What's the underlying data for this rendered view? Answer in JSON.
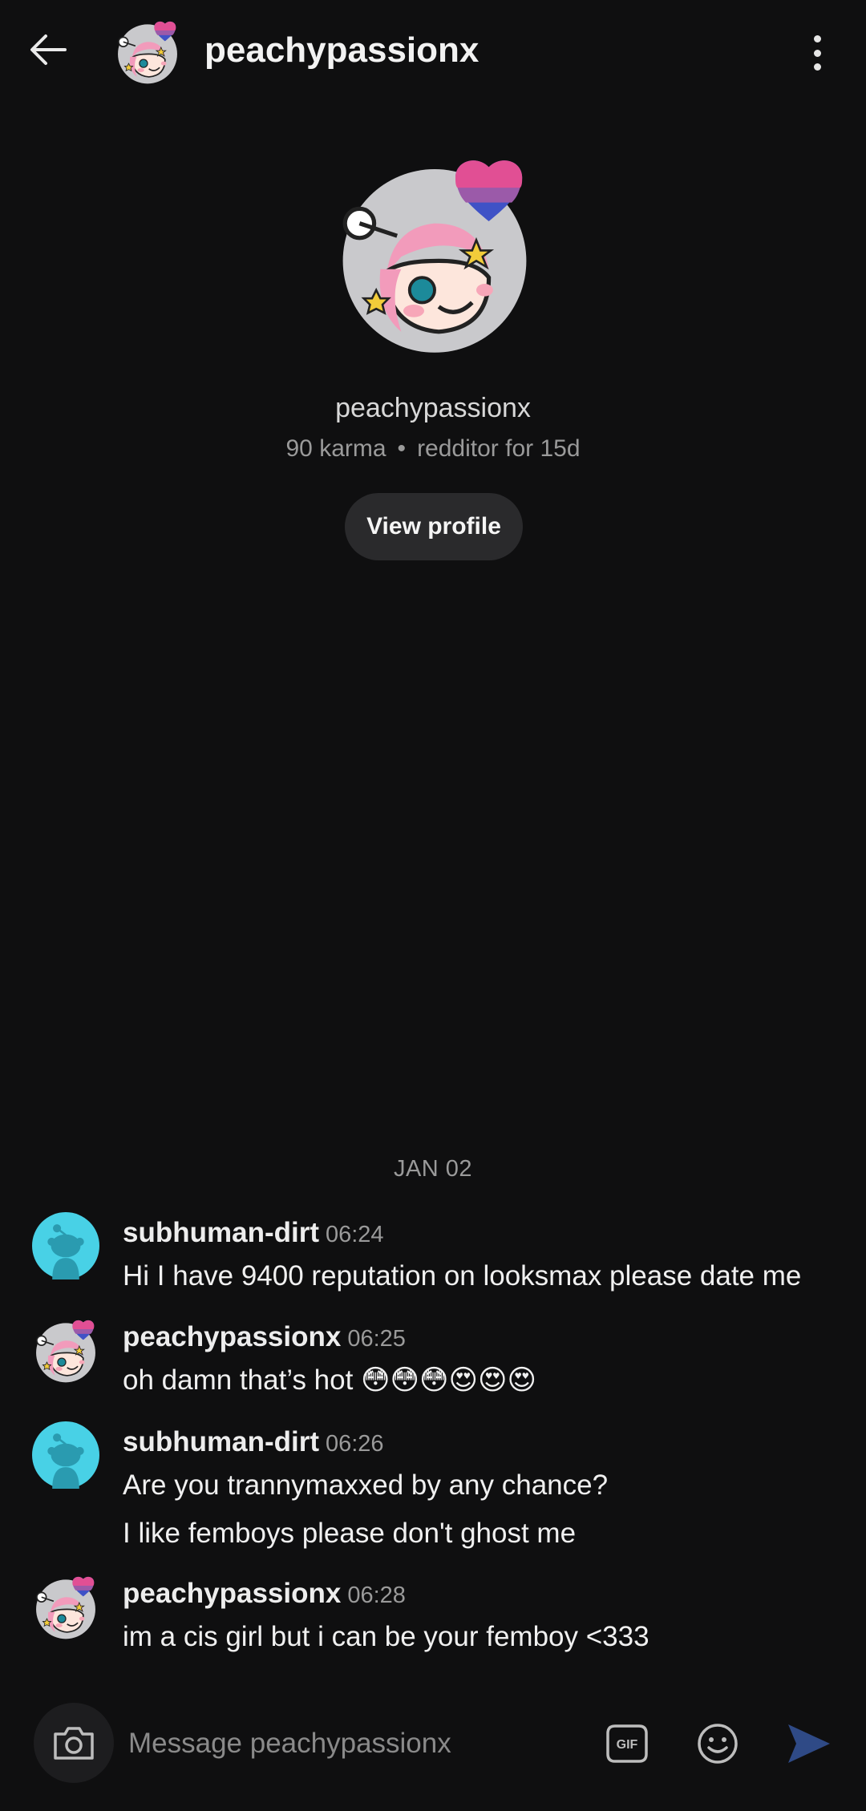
{
  "header": {
    "title": "peachypassionx",
    "back_icon": "arrow-left-icon",
    "more_icon": "more-vertical-icon"
  },
  "profile": {
    "name": "peachypassionx",
    "karma": "90 karma",
    "separator": "•",
    "age": "redditor for 15d",
    "view_profile_label": "View profile"
  },
  "date_separator": "JAN 02",
  "messages": [
    {
      "sender": "subhuman-dirt",
      "time": "06:24",
      "lines": [
        "Hi I have 9400 reputation on looksmax please date me"
      ]
    },
    {
      "sender": "peachypassionx",
      "time": "06:25",
      "lines": [
        "oh damn that’s hot 😳😳😳😍😍😍"
      ]
    },
    {
      "sender": "subhuman-dirt",
      "time": "06:26",
      "lines": [
        "Are you trannymaxxed by any chance?",
        "I like femboys please don't ghost me"
      ]
    },
    {
      "sender": "peachypassionx",
      "time": "06:28",
      "lines": [
        "im a cis girl but i can be your femboy <333"
      ]
    }
  ],
  "composer": {
    "placeholder": "Message peachypassionx",
    "camera_icon": "camera-icon",
    "gif_label": "GIF",
    "emoji_icon": "emoji-icon",
    "send_icon": "send-icon"
  },
  "colors": {
    "background": "#0f0f10",
    "button_bg": "#2a2a2c",
    "snoo_blue": "#48d1e6",
    "send_disabled": "#2f4a86"
  }
}
